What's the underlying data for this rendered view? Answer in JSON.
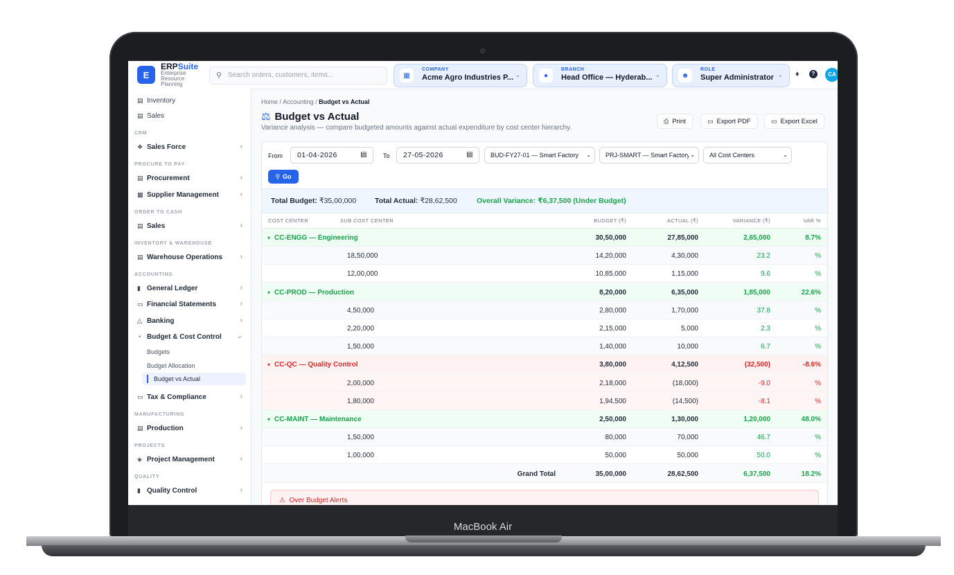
{
  "device": {
    "brand": "MacBook Air"
  },
  "app": {
    "logo_letter": "E",
    "name_part1": "ERP",
    "name_part2": "Suite",
    "tagline": "Enterprise Resource Planning"
  },
  "search": {
    "placeholder": "Search orders, customers, items..."
  },
  "context": {
    "company": {
      "label": "COMPANY",
      "value": "Acme Agro Industries P..."
    },
    "branch": {
      "label": "BRANCH",
      "value": "Head Office — Hyderab..."
    },
    "role": {
      "label": "ROLE",
      "value": "Super Administrator"
    }
  },
  "user": {
    "initials": "CA"
  },
  "sidebar": {
    "top_items": [
      "Inventory",
      "Sales"
    ],
    "sections": {
      "crm": "CRM",
      "p2p": "PROCURE TO PAY",
      "o2c": "ORDER TO CASH",
      "inv": "INVENTORY & WAREHOUSE",
      "acc": "ACCOUNTING",
      "mfg": "MANUFACTURING",
      "proj": "PROJECTS",
      "qual": "QUALITY"
    },
    "items": {
      "sales_force": "Sales Force",
      "procurement": "Procurement",
      "supplier": "Supplier Management",
      "sales": "Sales",
      "warehouse": "Warehouse Operations",
      "gl": "General Ledger",
      "fin": "Financial Statements",
      "banking": "Banking",
      "budget": "Budget & Cost Control",
      "tax": "Tax & Compliance",
      "production": "Production",
      "pm": "Project Management",
      "qc": "Quality Control"
    },
    "budget_sub": {
      "budgets": "Budgets",
      "allocation": "Budget Allocation",
      "bva": "Budget vs Actual"
    }
  },
  "breadcrumb": {
    "home": "Home",
    "sep": "/",
    "accounting": "Accounting",
    "current": "Budget vs Actual"
  },
  "page": {
    "title": "Budget vs Actual",
    "subtitle": "Variance analysis — compare budgeted amounts against actual expenditure by cost center hierarchy."
  },
  "actions": {
    "print": "Print",
    "export_pdf": "Export PDF",
    "export_excel": "Export Excel"
  },
  "filters": {
    "from_label": "From",
    "from_value": "01-04-2026",
    "to_label": "To",
    "to_value": "27-05-2026",
    "budget": "BUD-FY27-01 — Smart Factory",
    "project": "PRJ-SMART — Smart Factory",
    "cost_centers": "All Cost Centers",
    "go": "Go"
  },
  "summary": {
    "total_budget_label": "Total Budget:",
    "total_budget": "₹35,00,000",
    "total_actual_label": "Total Actual:",
    "total_actual": "₹28,62,500",
    "overall": "Overall Variance: ₹6,37,500 (Under Budget)"
  },
  "table": {
    "headers": [
      "COST CENTER",
      "SUB COST CENTER",
      "BUDGET (₹)",
      "ACTUAL (₹)",
      "VARIANCE (₹)",
      "VAR %"
    ],
    "groups": [
      {
        "name": "CC-ENGG — Engineering",
        "budget": "30,50,000",
        "actual": "27,85,000",
        "variance": "2,65,000",
        "pct": "8.7%",
        "status": "under",
        "rows": [
          {
            "sub": "18,50,000",
            "budget": "14,20,000",
            "actual": "4,30,000",
            "variance": "23.2",
            "pct": "%"
          },
          {
            "sub": "12,00,000",
            "budget": "10,85,000",
            "actual": "1,15,000",
            "variance": "9.6",
            "pct": "%"
          }
        ]
      },
      {
        "name": "CC-PROD — Production",
        "budget": "8,20,000",
        "actual": "6,35,000",
        "variance": "1,85,000",
        "pct": "22.6%",
        "status": "under",
        "rows": [
          {
            "sub": "4,50,000",
            "budget": "2,80,000",
            "actual": "1,70,000",
            "variance": "37.8",
            "pct": "%"
          },
          {
            "sub": "2,20,000",
            "budget": "2,15,000",
            "actual": "5,000",
            "variance": "2.3",
            "pct": "%"
          },
          {
            "sub": "1,50,000",
            "budget": "1,40,000",
            "actual": "10,000",
            "variance": "6.7",
            "pct": "%"
          }
        ]
      },
      {
        "name": "CC-QC — Quality Control",
        "budget": "3,80,000",
        "actual": "4,12,500",
        "variance": "(32,500)",
        "pct": "-8.6%",
        "status": "over",
        "rows": [
          {
            "sub": "2,00,000",
            "budget": "2,18,000",
            "actual": "(18,000)",
            "variance": "-9.0",
            "pct": "%"
          },
          {
            "sub": "1,80,000",
            "budget": "1,94,500",
            "actual": "(14,500)",
            "variance": "-8.1",
            "pct": "%"
          }
        ]
      },
      {
        "name": "CC-MAINT — Maintenance",
        "budget": "2,50,000",
        "actual": "1,30,000",
        "variance": "1,20,000",
        "pct": "48.0%",
        "status": "under",
        "rows": [
          {
            "sub": "1,50,000",
            "budget": "80,000",
            "actual": "70,000",
            "variance": "46.7",
            "pct": "%"
          },
          {
            "sub": "1,00,000",
            "budget": "50,000",
            "actual": "50,000",
            "variance": "50.0",
            "pct": "%"
          }
        ]
      }
    ],
    "grand_total": {
      "label": "Grand Total",
      "budget": "35,00,000",
      "actual": "28,62,500",
      "variance": "6,37,500",
      "pct": "18.2%"
    }
  },
  "alert": {
    "title": "Over Budget Alerts"
  },
  "colors": {
    "accent": "#2563eb",
    "positive": "#16a34a",
    "negative": "#dc2626"
  }
}
